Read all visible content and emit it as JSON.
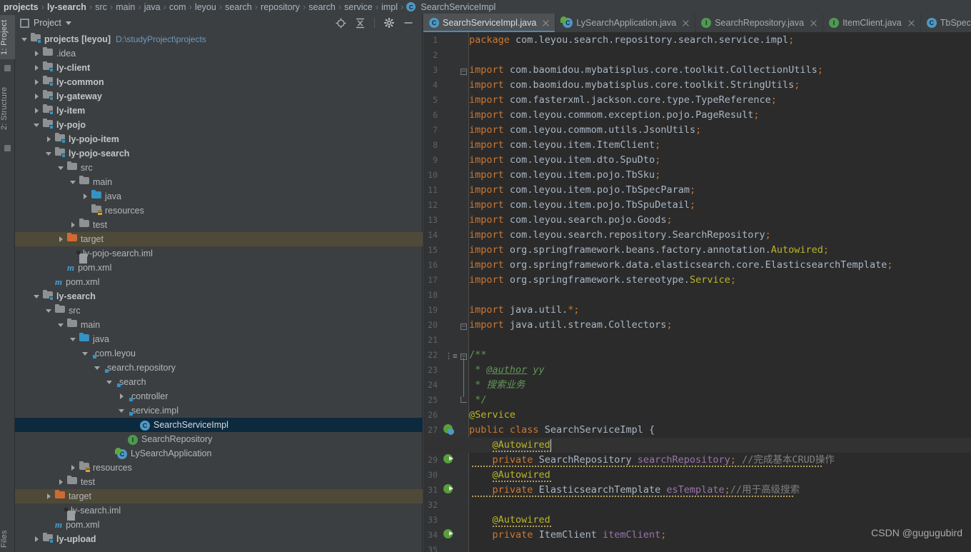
{
  "breadcrumb": {
    "items": [
      {
        "label": "projects",
        "bold": true
      },
      {
        "label": "ly-search",
        "bold": true
      },
      {
        "label": "src",
        "bold": false
      },
      {
        "label": "main",
        "bold": false
      },
      {
        "label": "java",
        "bold": false
      },
      {
        "label": "com",
        "bold": false
      },
      {
        "label": "leyou",
        "bold": false
      },
      {
        "label": "search",
        "bold": false
      },
      {
        "label": "repository",
        "bold": false
      },
      {
        "label": "search",
        "bold": false
      },
      {
        "label": "service",
        "bold": false
      },
      {
        "label": "impl",
        "bold": false
      }
    ],
    "final_class": "SearchServiceImpl",
    "final_icon": "class-icon",
    "separator": "›"
  },
  "left_strip": {
    "tabs": [
      {
        "label": "1: Project",
        "active": true
      },
      {
        "label": "2: Structure",
        "active": false
      }
    ],
    "bottom_label": "Files"
  },
  "project_panel": {
    "title": "Project",
    "title_icon": "project-view-icon",
    "dropdown_icon": "chevron-down-icon",
    "tools": [
      {
        "name": "locate-in-tree-icon",
        "title": "Select Opened File"
      },
      {
        "name": "collapse-all-icon",
        "title": "Collapse All"
      },
      {
        "name": "gear-icon",
        "title": "Settings"
      },
      {
        "name": "minimize-icon",
        "title": "Hide"
      }
    ],
    "tree": [
      {
        "depth": 0,
        "twisty": "d",
        "icon": "module-folder",
        "label": "projects [leyou]",
        "bold": true,
        "path": "D:\\studyProject\\projects",
        "state": "normal"
      },
      {
        "depth": 1,
        "twisty": "r",
        "icon": "folder-gray",
        "label": ".idea",
        "bold": false,
        "state": "normal"
      },
      {
        "depth": 1,
        "twisty": "r",
        "icon": "module-folder",
        "label": "ly-client",
        "bold": true,
        "state": "normal"
      },
      {
        "depth": 1,
        "twisty": "r",
        "icon": "module-folder",
        "label": "ly-common",
        "bold": true,
        "state": "normal"
      },
      {
        "depth": 1,
        "twisty": "r",
        "icon": "module-folder",
        "label": "ly-gateway",
        "bold": true,
        "state": "normal"
      },
      {
        "depth": 1,
        "twisty": "r",
        "icon": "module-folder",
        "label": "ly-item",
        "bold": true,
        "state": "normal"
      },
      {
        "depth": 1,
        "twisty": "d",
        "icon": "module-folder",
        "label": "ly-pojo",
        "bold": true,
        "state": "normal"
      },
      {
        "depth": 2,
        "twisty": "r",
        "icon": "module-folder",
        "label": "ly-pojo-item",
        "bold": true,
        "state": "normal"
      },
      {
        "depth": 2,
        "twisty": "d",
        "icon": "module-folder",
        "label": "ly-pojo-search",
        "bold": true,
        "state": "normal"
      },
      {
        "depth": 3,
        "twisty": "d",
        "icon": "folder-gray",
        "label": "src",
        "bold": false,
        "state": "normal"
      },
      {
        "depth": 4,
        "twisty": "d",
        "icon": "folder-gray",
        "label": "main",
        "bold": false,
        "state": "normal"
      },
      {
        "depth": 5,
        "twisty": "r",
        "icon": "folder-blue",
        "label": "java",
        "bold": false,
        "state": "normal"
      },
      {
        "depth": 5,
        "twisty": "",
        "icon": "folder-resources",
        "label": "resources",
        "bold": false,
        "state": "normal"
      },
      {
        "depth": 4,
        "twisty": "r",
        "icon": "folder-gray",
        "label": "test",
        "bold": false,
        "state": "normal"
      },
      {
        "depth": 3,
        "twisty": "r",
        "icon": "folder-orange",
        "label": "target",
        "bold": false,
        "state": "target"
      },
      {
        "depth": 4,
        "twisty": "",
        "icon": "iml-file",
        "label": "ly-pojo-search.iml",
        "bold": false,
        "state": "normal"
      },
      {
        "depth": 3,
        "twisty": "",
        "icon": "maven-file",
        "label": "pom.xml",
        "bold": false,
        "state": "normal"
      },
      {
        "depth": 2,
        "twisty": "",
        "icon": "maven-file",
        "label": "pom.xml",
        "bold": false,
        "state": "normal"
      },
      {
        "depth": 1,
        "twisty": "d",
        "icon": "module-folder",
        "label": "ly-search",
        "bold": true,
        "state": "normal"
      },
      {
        "depth": 2,
        "twisty": "d",
        "icon": "folder-gray",
        "label": "src",
        "bold": false,
        "state": "normal"
      },
      {
        "depth": 3,
        "twisty": "d",
        "icon": "folder-gray",
        "label": "main",
        "bold": false,
        "state": "normal"
      },
      {
        "depth": 4,
        "twisty": "d",
        "icon": "folder-blue",
        "label": "java",
        "bold": false,
        "state": "normal"
      },
      {
        "depth": 5,
        "twisty": "d",
        "icon": "package-icon",
        "label": "com.leyou",
        "bold": false,
        "state": "normal"
      },
      {
        "depth": 6,
        "twisty": "d",
        "icon": "package-icon",
        "label": "search.repository",
        "bold": false,
        "state": "normal"
      },
      {
        "depth": 7,
        "twisty": "d",
        "icon": "package-icon",
        "label": "search",
        "bold": false,
        "state": "normal"
      },
      {
        "depth": 8,
        "twisty": "r",
        "icon": "package-icon",
        "label": "controller",
        "bold": false,
        "state": "normal"
      },
      {
        "depth": 8,
        "twisty": "d",
        "icon": "package-icon",
        "label": "service.impl",
        "bold": false,
        "state": "normal"
      },
      {
        "depth": 9,
        "twisty": "",
        "icon": "class-icon",
        "label": "SearchServiceImpl",
        "bold": false,
        "state": "selected"
      },
      {
        "depth": 8,
        "twisty": "",
        "icon": "interface-icon",
        "label": "SearchRepository",
        "bold": false,
        "state": "normal"
      },
      {
        "depth": 7,
        "twisty": "",
        "icon": "spring-boot-icon",
        "label": "LySearchApplication",
        "bold": false,
        "state": "normal"
      },
      {
        "depth": 4,
        "twisty": "r",
        "icon": "folder-resources",
        "label": "resources",
        "bold": false,
        "state": "normal"
      },
      {
        "depth": 3,
        "twisty": "r",
        "icon": "folder-gray",
        "label": "test",
        "bold": false,
        "state": "normal"
      },
      {
        "depth": 2,
        "twisty": "r",
        "icon": "folder-orange",
        "label": "target",
        "bold": false,
        "state": "target"
      },
      {
        "depth": 3,
        "twisty": "",
        "icon": "iml-file",
        "label": "ly-search.iml",
        "bold": false,
        "state": "normal"
      },
      {
        "depth": 2,
        "twisty": "",
        "icon": "maven-file",
        "label": "pom.xml",
        "bold": false,
        "state": "normal"
      },
      {
        "depth": 1,
        "twisty": "r",
        "icon": "module-folder",
        "label": "ly-upload",
        "bold": true,
        "state": "normal"
      }
    ]
  },
  "editor": {
    "tabs": [
      {
        "label": "SearchServiceImpl.java",
        "icon": "class-icon",
        "active": true,
        "closable": true
      },
      {
        "label": "LySearchApplication.java",
        "icon": "spring-boot-icon",
        "active": false,
        "closable": true
      },
      {
        "label": "SearchRepository.java",
        "icon": "interface-icon",
        "active": false,
        "closable": true
      },
      {
        "label": "ItemClient.java",
        "icon": "interface-icon",
        "active": false,
        "closable": true
      },
      {
        "label": "TbSpecP",
        "icon": "class-icon",
        "active": false,
        "closable": false
      }
    ],
    "current_line": 28,
    "first_line": 1,
    "last_visible_line": 35,
    "lines": [
      {
        "n": 1,
        "text": "package com.leyou.search.repository.search.service.impl;"
      },
      {
        "n": 2,
        "text": ""
      },
      {
        "n": 3,
        "text": "import com.baomidou.mybatisplus.core.toolkit.CollectionUtils;"
      },
      {
        "n": 4,
        "text": "import com.baomidou.mybatisplus.core.toolkit.StringUtils;"
      },
      {
        "n": 5,
        "text": "import com.fasterxml.jackson.core.type.TypeReference;"
      },
      {
        "n": 6,
        "text": "import com.leyou.commom.exception.pojo.PageResult;"
      },
      {
        "n": 7,
        "text": "import com.leyou.commom.utils.JsonUtils;"
      },
      {
        "n": 8,
        "text": "import com.leyou.item.ItemClient;"
      },
      {
        "n": 9,
        "text": "import com.leyou.item.dto.SpuDto;"
      },
      {
        "n": 10,
        "text": "import com.leyou.item.pojo.TbSku;"
      },
      {
        "n": 11,
        "text": "import com.leyou.item.pojo.TbSpecParam;"
      },
      {
        "n": 12,
        "text": "import com.leyou.item.pojo.TbSpuDetail;"
      },
      {
        "n": 13,
        "text": "import com.leyou.search.pojo.Goods;"
      },
      {
        "n": 14,
        "text": "import com.leyou.search.repository.SearchRepository;"
      },
      {
        "n": 15,
        "text": "import org.springframework.beans.factory.annotation.Autowired;"
      },
      {
        "n": 16,
        "text": "import org.springframework.data.elasticsearch.core.ElasticsearchTemplate;"
      },
      {
        "n": 17,
        "text": "import org.springframework.stereotype.Service;"
      },
      {
        "n": 18,
        "text": ""
      },
      {
        "n": 19,
        "text": "import java.util.*;"
      },
      {
        "n": 20,
        "text": "import java.util.stream.Collectors;"
      },
      {
        "n": 21,
        "text": ""
      },
      {
        "n": 22,
        "text": "/**"
      },
      {
        "n": 23,
        "text": " * @author yy"
      },
      {
        "n": 24,
        "text": " * 搜索业务"
      },
      {
        "n": 25,
        "text": " */"
      },
      {
        "n": 26,
        "text": "@Service"
      },
      {
        "n": 27,
        "text": "public class SearchServiceImpl {"
      },
      {
        "n": 28,
        "text": "    @Autowired"
      },
      {
        "n": 29,
        "text": "    private SearchRepository searchRepository; //完成基本CRUD操作"
      },
      {
        "n": 30,
        "text": "    @Autowired"
      },
      {
        "n": 31,
        "text": "    private ElasticsearchTemplate esTemplate;//用于高级搜索"
      },
      {
        "n": 32,
        "text": ""
      },
      {
        "n": 33,
        "text": "    @Autowired"
      },
      {
        "n": 34,
        "text": "    private ItemClient itemClient;"
      },
      {
        "n": 35,
        "text": ""
      }
    ],
    "gutter_icons": [
      {
        "line": 27,
        "icon": "spring-bean-class-icon"
      },
      {
        "line": 28,
        "icon": "intention-bulb-icon"
      },
      {
        "line": 29,
        "icon": "spring-autowired-icon"
      },
      {
        "line": 31,
        "icon": "spring-autowired-icon"
      },
      {
        "line": 34,
        "icon": "spring-autowired-icon"
      },
      {
        "line": 22,
        "icon": "structure-marker-icon"
      }
    ],
    "fold_markers": [
      {
        "line": 3,
        "type": "minus"
      },
      {
        "line": 20,
        "type": "minus"
      },
      {
        "line": 22,
        "type": "minus"
      },
      {
        "line": 25,
        "type": "end"
      }
    ]
  },
  "watermark": "CSDN @gugugubird",
  "colors": {
    "editor_bg": "#2b2b2b",
    "panel_bg": "#3c3f41",
    "gutter_bg": "#313335",
    "selection_blue": "#0d293e",
    "target_highlight": "#4f4a38",
    "tab_active": "#4e5254",
    "tab_underline": "#4a88c7",
    "keyword": "#cc7832",
    "annotation": "#bbb529",
    "comment": "#808080",
    "doc_comment": "#629755",
    "field": "#9876aa",
    "text": "#a9b7c6"
  }
}
